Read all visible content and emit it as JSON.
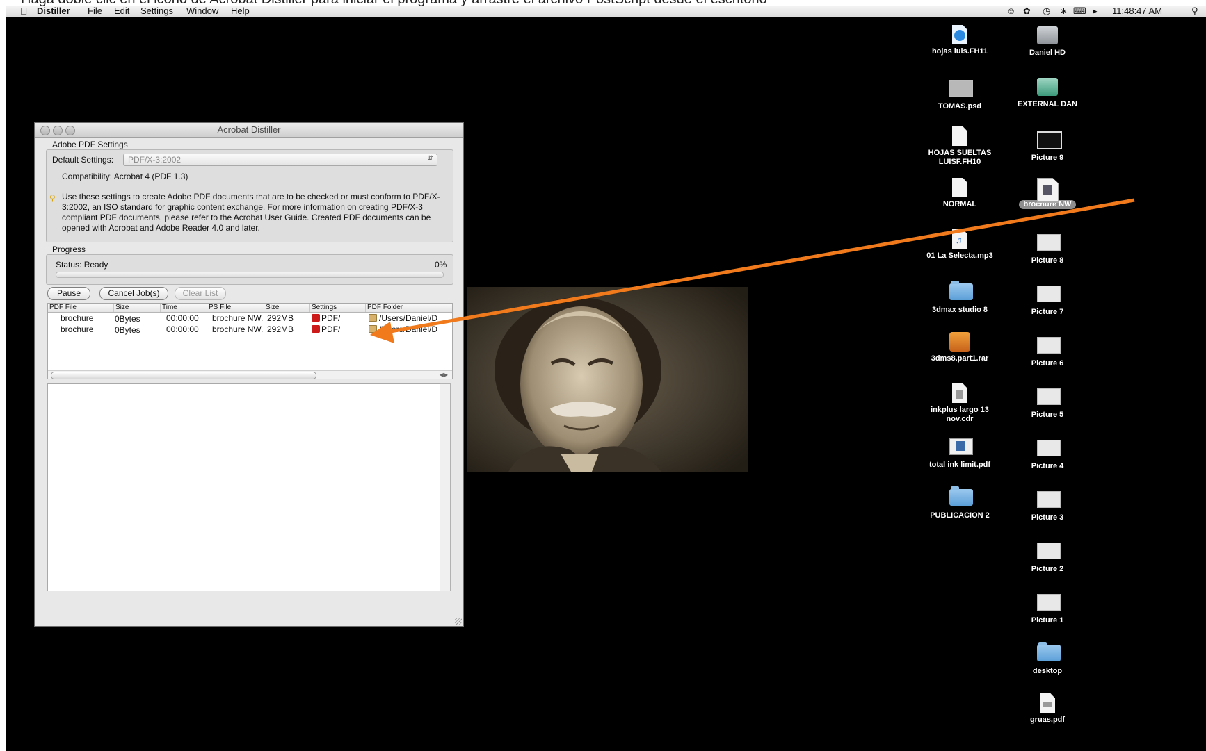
{
  "caption": "Haga doble clic en el icono de Acrobat Distiller para iniciar el programa y arrastre el archivo PostScript desde el escritorio",
  "menubar": {
    "apple_icon": "apple-logo",
    "app_name": "Distiller",
    "items": [
      "File",
      "Edit",
      "Settings",
      "Window",
      "Help"
    ],
    "clock": "11:48:47 AM",
    "status_icons": [
      "user-icon",
      "paw-icon",
      "time-machine-icon",
      "bluetooth-icon",
      "wifi-icon",
      "volume-icon",
      "spotlight-icon"
    ]
  },
  "window": {
    "title": "Acrobat Distiller",
    "pdf_settings_header": "Adobe PDF Settings",
    "default_settings_label": "Default Settings:",
    "default_settings_value": "PDF/X-3:2002",
    "compatibility": "Compatibility: Acrobat 4 (PDF 1.3)",
    "description": "Use these settings to create Adobe PDF documents that are to be checked or must conform to PDF/X-3:2002, an ISO standard for graphic content exchange.  For more information on creating PDF/X-3 compliant PDF documents, please refer to the Acrobat User Guide.  Created PDF documents can be opened with Acrobat and Adobe Reader 4.0 and later.",
    "progress_header": "Progress",
    "status": "Status:  Ready",
    "percent": "0%",
    "progress_fraction": 0,
    "buttons": {
      "pause": "Pause",
      "cancel": "Cancel Job(s)",
      "clear": "Clear List"
    },
    "columns": [
      "PDF File",
      "Size",
      "Time",
      "PS File",
      "Size",
      "Settings",
      "PDF Folder"
    ],
    "rows": [
      {
        "pdf_file": "brochure",
        "size": "0Bytes",
        "time": "00:00:00",
        "ps_file": "brochure NW.",
        "ps_size": "292MB",
        "settings": "PDF/",
        "folder": "/Users/Daniel/D"
      },
      {
        "pdf_file": "brochure",
        "size": "0Bytes",
        "time": "00:00:00",
        "ps_file": "brochure NW.",
        "ps_size": "292MB",
        "settings": "PDF/",
        "folder": "/Users/Daniel/D"
      }
    ]
  },
  "desktop_icons": {
    "left_column": [
      "hojas luis.FH11",
      "TOMAS.psd",
      "HOJAS SUELTAS LUISF.FH10",
      "NORMAL",
      "01 La Selecta.mp3",
      "3dmax studio 8",
      "3dms8.part1.rar",
      "inkplus largo 13 nov.cdr",
      "total ink limit.pdf",
      "PUBLICACION 2"
    ],
    "right_column": [
      "Daniel HD",
      "EXTERNAL DAN",
      "Picture 9",
      "brochure NW",
      "Picture 8",
      "Picture 7",
      "Picture 6",
      "Picture 5",
      "Picture 4",
      "Picture 3",
      "Picture 2",
      "Picture 1",
      "desktop",
      "gruas.pdf"
    ]
  },
  "colors": {
    "arrow": "#f07a1c",
    "desktop": "#000000"
  }
}
